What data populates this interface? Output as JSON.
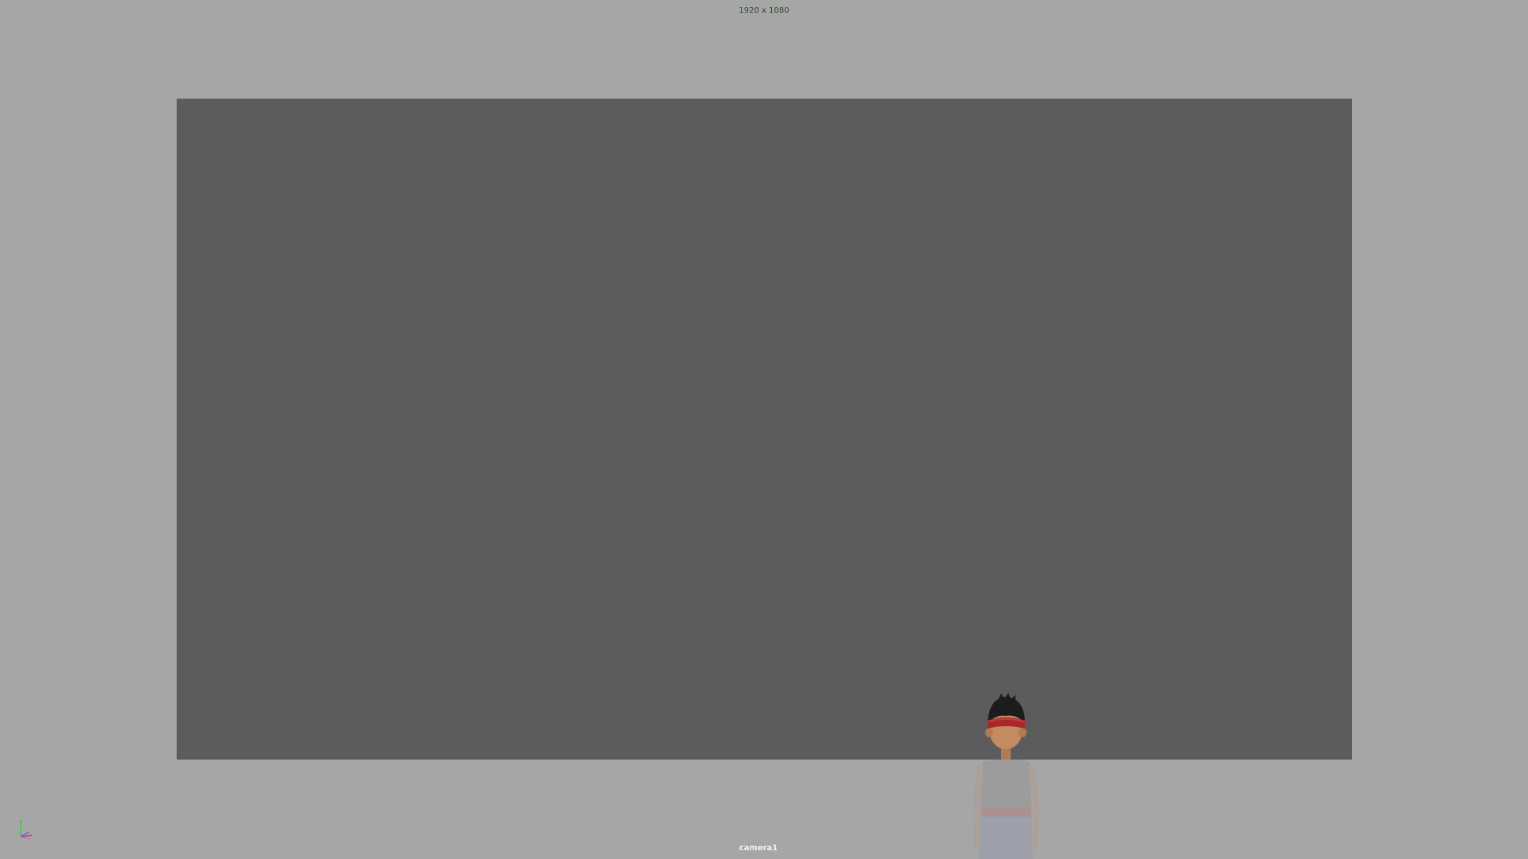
{
  "viewport": {
    "resolution_text": "1920 x 1080",
    "camera_name": "camera1",
    "background_color": "#a6a6a6",
    "gate_color": "#5c5c5c"
  },
  "scene": {
    "objects": [
      {
        "name": "character",
        "icon": "character-model"
      }
    ]
  },
  "gizmo": {
    "axes": [
      "y",
      "x",
      "z"
    ],
    "colors": {
      "x": "#d6453d",
      "y": "#4fc04f",
      "z": "#4a6fe0"
    }
  }
}
